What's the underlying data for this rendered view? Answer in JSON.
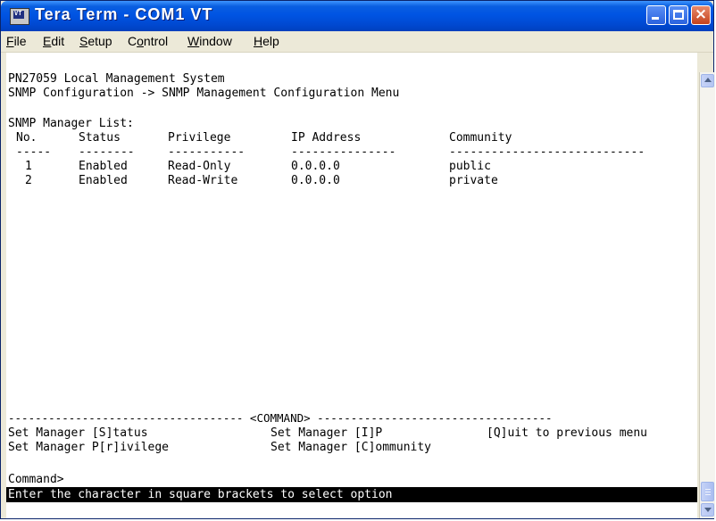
{
  "window": {
    "title": "Tera Term - COM1 VT",
    "icon_label": "VT"
  },
  "menu": {
    "items": [
      {
        "label": "File",
        "mnemonic": "F"
      },
      {
        "label": "Edit",
        "mnemonic": "E"
      },
      {
        "label": "Setup",
        "mnemonic": "S"
      },
      {
        "label": "Control",
        "mnemonic": "o"
      },
      {
        "label": "Window",
        "mnemonic": "W"
      },
      {
        "label": "Help",
        "mnemonic": "H"
      }
    ]
  },
  "terminal": {
    "system_name": "PN27059 Local Management System",
    "breadcrumb": "SNMP Configuration -> SNMP Management Configuration Menu",
    "list_title": "SNMP Manager List:",
    "columns": {
      "no": "No.",
      "status": "Status",
      "privilege": "Privilege",
      "ip": "IP Address",
      "community": "Community"
    },
    "separators": {
      "no": "-----",
      "status": "--------",
      "privilege": "-----------",
      "ip": "---------------",
      "community": "----------------------------"
    },
    "rows": [
      {
        "no": "1",
        "status": "Enabled",
        "privilege": "Read-Only",
        "ip": "0.0.0.0",
        "community": "public"
      },
      {
        "no": "2",
        "status": "Enabled",
        "privilege": "Read-Write",
        "ip": "0.0.0.0",
        "community": "private"
      }
    ],
    "command_bar": "----------------------------------- <COMMAND> -----------------------------------",
    "commands": {
      "set_status": "Set Manager [S]tatus",
      "set_ip": "Set Manager [I]P",
      "quit": "[Q]uit to previous menu",
      "set_privilege": "Set Manager P[r]ivilege",
      "set_community": "Set Manager [C]ommunity"
    },
    "prompt": "Command>",
    "status_line": "Enter the character in square brackets to select option"
  }
}
